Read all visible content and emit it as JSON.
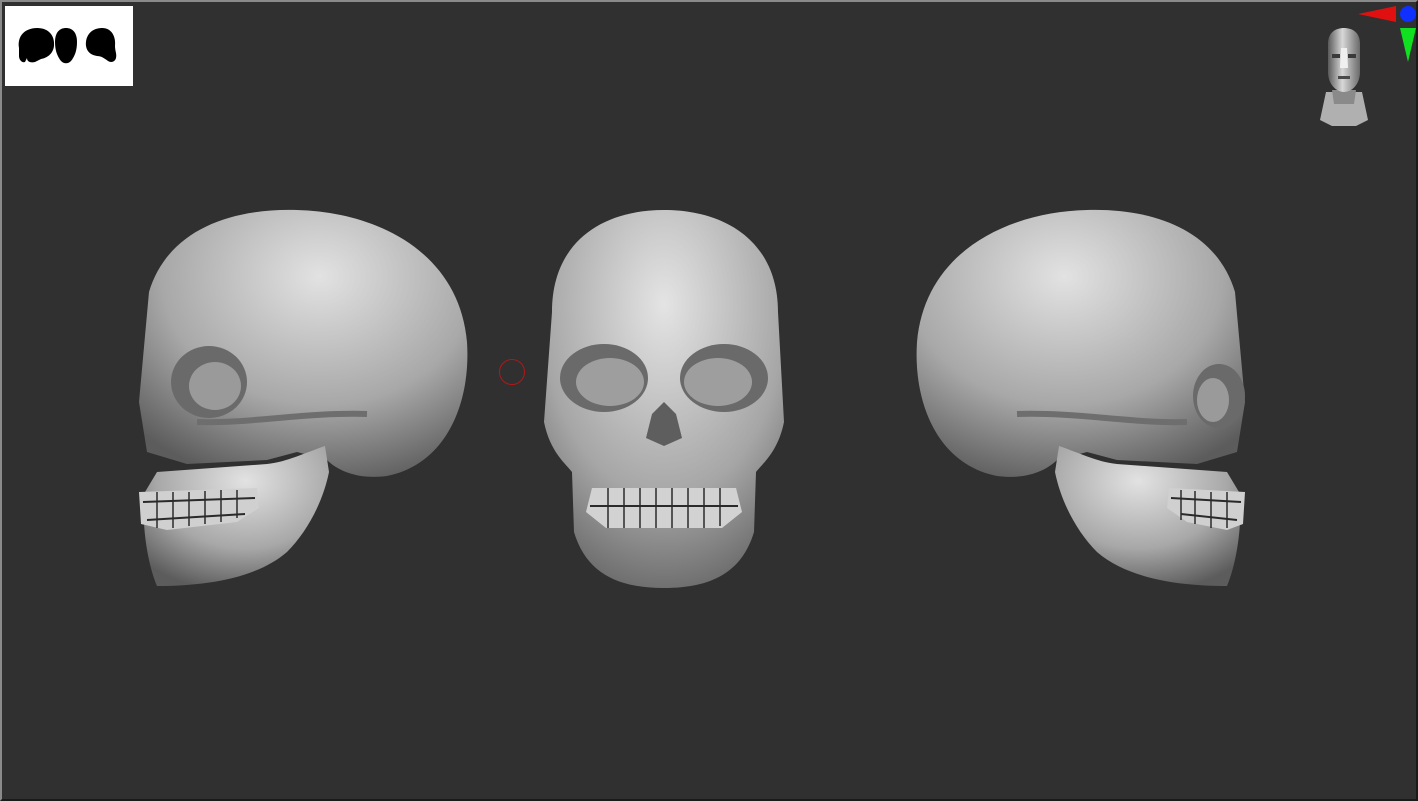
{
  "app": {
    "name": "ZBrush viewport"
  },
  "viewport": {
    "background_color": "#303030",
    "thumbnail": {
      "icon": "silhouette-thumbnail-icon",
      "background_color": "#ffffff",
      "silhouette_color": "#000000"
    },
    "axis_gizmo": {
      "icon": "axis-gizmo-icon",
      "x_color": "#ff0000",
      "y_color": "#00ff00",
      "z_color": "#0000ff"
    },
    "navigation_head": {
      "icon": "navigation-head-icon"
    },
    "brush_cursor": {
      "icon": "brush-cursor-icon",
      "color": "#b01818"
    },
    "models": [
      {
        "view": "left",
        "icon": "skull-left-view"
      },
      {
        "view": "front",
        "icon": "skull-front-view"
      },
      {
        "view": "right",
        "icon": "skull-right-view"
      }
    ]
  }
}
